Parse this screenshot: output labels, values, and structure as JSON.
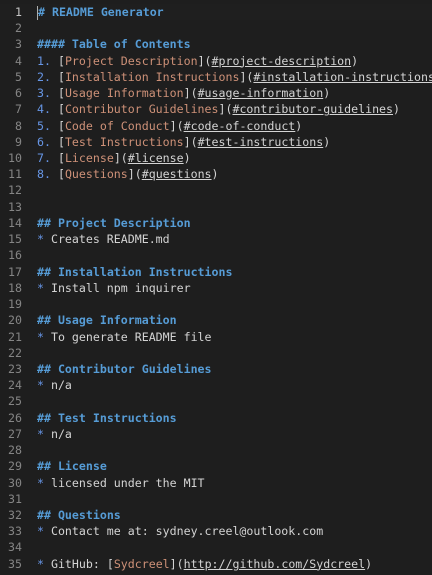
{
  "line_numbers": [
    "1",
    "2",
    "3",
    "4",
    "5",
    "6",
    "7",
    "8",
    "9",
    "10",
    "11",
    "12",
    "13",
    "14",
    "15",
    "16",
    "17",
    "18",
    "19",
    "20",
    "21",
    "22",
    "23",
    "24",
    "25",
    "26",
    "27",
    "28",
    "29",
    "30",
    "31",
    "32",
    "33",
    "34",
    "35"
  ],
  "title": {
    "mark": "#",
    "text": "README Generator"
  },
  "toc": {
    "mark": "####",
    "text": "Table of Contents"
  },
  "toc_items": [
    {
      "num": "1.",
      "text": "Project Description",
      "url": "#project-description"
    },
    {
      "num": "2.",
      "text": "Installation Instructions",
      "url": "#installation-instructions"
    },
    {
      "num": "3.",
      "text": "Usage Information",
      "url": "#usage-information"
    },
    {
      "num": "4.",
      "text": "Contributor Guidelines",
      "url": "#contributor-guidelines"
    },
    {
      "num": "5.",
      "text": "Code of Conduct",
      "url": "#code-of-conduct"
    },
    {
      "num": "6.",
      "text": "Test Instructions",
      "url": "#test-instructions"
    },
    {
      "num": "7.",
      "text": "License",
      "url": "#license"
    },
    {
      "num": "8.",
      "text": "Questions",
      "url": "#questions"
    }
  ],
  "sections": [
    {
      "mark": "##",
      "heading": "Project Description",
      "bullet": "*",
      "body": "Creates README.md"
    },
    {
      "mark": "##",
      "heading": "Installation Instructions",
      "bullet": "*",
      "body": "Install npm inquirer"
    },
    {
      "mark": "##",
      "heading": "Usage Information",
      "bullet": "*",
      "body": "To generate README file"
    },
    {
      "mark": "##",
      "heading": "Contributor Guidelines",
      "bullet": "*",
      "body": "n/a"
    },
    {
      "mark": "##",
      "heading": "Test Instructions",
      "bullet": "*",
      "body": "n/a"
    },
    {
      "mark": "##",
      "heading": "License",
      "bullet": "*",
      "body": "licensed under the MIT"
    },
    {
      "mark": "##",
      "heading": "Questions",
      "bullet": "*",
      "body": "Contact me at: sydney.creel@outlook.com"
    }
  ],
  "github": {
    "bullet": "*",
    "label": "GitHub:",
    "link_text": "Sydcreel",
    "url": "http://github.com/Sydcreel"
  },
  "colors": {
    "background": "#1e1e1e",
    "heading": "#569cd6",
    "link_text": "#ce9178",
    "text": "#d4d4d4",
    "gutter": "#858585"
  }
}
